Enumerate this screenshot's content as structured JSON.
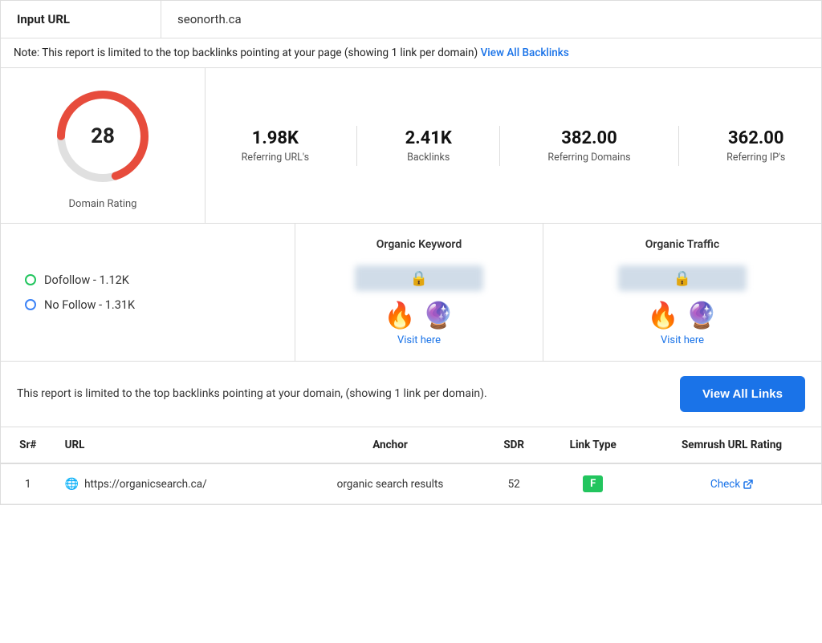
{
  "input_url_label": "Input URL",
  "input_url_value": "seonorth.ca",
  "note_text": "Note: This report is limited to the top backlinks pointing at your page (showing 1 link per domain)",
  "note_link_label": "View All Backlinks",
  "domain_rating": {
    "label": "Domain Rating",
    "value": "28"
  },
  "metrics": [
    {
      "value": "1.98K",
      "label": "Referring URL's"
    },
    {
      "value": "2.41K",
      "label": "Backlinks"
    },
    {
      "value": "382.00",
      "label": "Referring Domains"
    },
    {
      "value": "362.00",
      "label": "Referring IP's"
    }
  ],
  "follow_items": [
    {
      "type": "green",
      "label": "Dofollow - 1.12K"
    },
    {
      "type": "blue",
      "label": "No Follow - 1.31K"
    }
  ],
  "organic_keyword": {
    "title": "Organic Keyword",
    "visit_label": "Visit here"
  },
  "organic_traffic": {
    "title": "Organic Traffic",
    "visit_label": "Visit here"
  },
  "view_all_section": {
    "text": "This report is limited to the top backlinks pointing at your domain, (showing 1 link per domain).",
    "button_label": "View All Links"
  },
  "table": {
    "headers": [
      "Sr#",
      "URL",
      "Anchor",
      "SDR",
      "Link Type",
      "Semrush URL Rating"
    ],
    "rows": [
      {
        "sr": "1",
        "url": "https://organicsearch.ca/",
        "anchor": "organic search results",
        "sdr": "52",
        "link_type": "F",
        "semrush": "Check"
      }
    ]
  }
}
